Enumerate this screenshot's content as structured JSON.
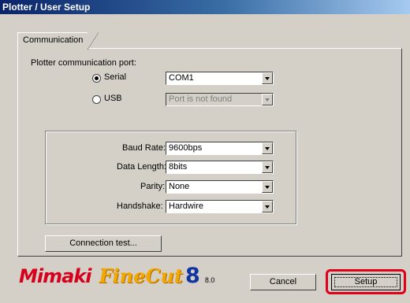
{
  "window": {
    "title": "Plotter / User Setup"
  },
  "tabs": [
    {
      "label": "Communication"
    }
  ],
  "port": {
    "heading": "Plotter communication port:",
    "serial": {
      "label": "Serial",
      "selected": true,
      "value": "COM1"
    },
    "usb": {
      "label": "USB",
      "selected": false,
      "value": "Port is not found"
    }
  },
  "settings": {
    "baud": {
      "label": "Baud Rate:",
      "value": "9600bps"
    },
    "data_length": {
      "label": "Data Length:",
      "value": "8bits"
    },
    "parity": {
      "label": "Parity:",
      "value": "None"
    },
    "handshake": {
      "label": "Handshake:",
      "value": "Hardwire"
    }
  },
  "buttons": {
    "connection_test": "Connection test...",
    "cancel": "Cancel",
    "setup": "Setup"
  },
  "logo": {
    "brand": "Mimaki",
    "product": "FineCut",
    "version_mark": "8",
    "version": "8.0"
  },
  "colors": {
    "highlight": "#e0001a",
    "brand_red": "#d6001c",
    "finecut_yellow": "#f2a800",
    "version_blue": "#1034a0"
  }
}
